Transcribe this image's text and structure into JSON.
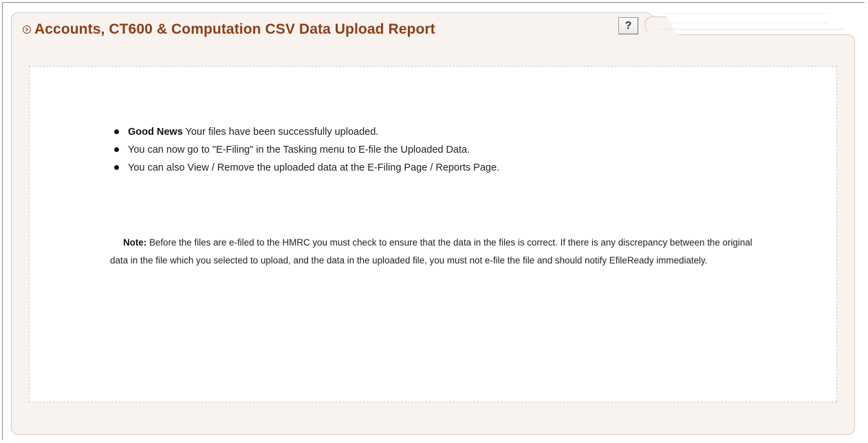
{
  "header": {
    "title": "Accounts, CT600 & Computation CSV Data Upload Report",
    "help_label": "?"
  },
  "messages": {
    "bullet1_bold": "Good News",
    "bullet1_text": " Your files have been successfully uploaded.",
    "bullet2_text": "You can now go to \"E-Filing\" in the Tasking menu to E-file the Uploaded Data.",
    "bullet3_text": "You can also View / Remove the uploaded data at the E-Filing Page / Reports Page."
  },
  "note": {
    "label": "Note:",
    "text": " Before the files are e-filed to the HMRC you must check to ensure that the data in the files is correct. If there is any discrepancy between the original data in the file which you selected to upload, and the data in the uploaded file, you must not e-file the file and should notify EfileReady immediately."
  },
  "colors": {
    "title": "#8b3f17",
    "panel_bg": "#f8f3ef"
  },
  "icons": {
    "title_icon": "circle-chevron-right-icon",
    "bullet_icon": "bullet-dot-icon"
  }
}
